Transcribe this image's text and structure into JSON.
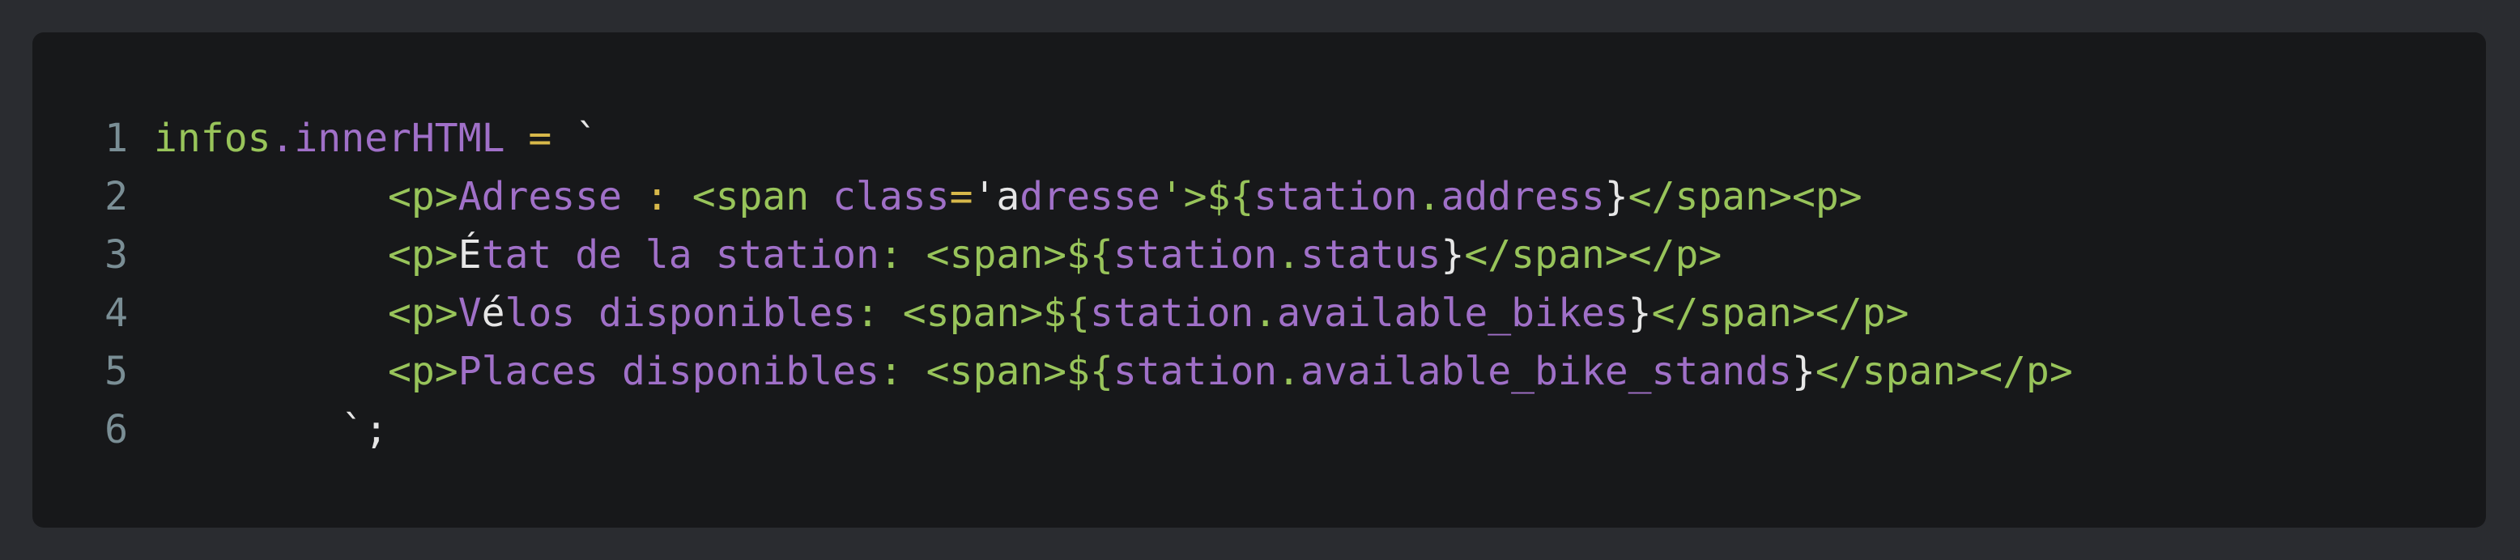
{
  "colors": {
    "background": "#2a2c30",
    "panel": "#17181a",
    "line_numbers": "#7a8e95",
    "tag_green": "#98c45a",
    "text_purple": "#a070c8",
    "operator_yellow": "#d7b84a",
    "plain_white": "#e6e6e6"
  },
  "code": {
    "lines": [
      {
        "number": "1",
        "segments": [
          {
            "text": "infos",
            "color": "g"
          },
          {
            "text": ".innerHTML ",
            "color": "p"
          },
          {
            "text": "=",
            "color": "y"
          },
          {
            "text": " `",
            "color": "w"
          }
        ]
      },
      {
        "number": "2",
        "segments": [
          {
            "text": "          ",
            "color": "p"
          },
          {
            "text": "<p>",
            "color": "g"
          },
          {
            "text": "Adresse ",
            "color": "p"
          },
          {
            "text": ":",
            "color": "y"
          },
          {
            "text": " ",
            "color": "p"
          },
          {
            "text": "<span ",
            "color": "g"
          },
          {
            "text": "class",
            "color": "p"
          },
          {
            "text": "=",
            "color": "y"
          },
          {
            "text": "'a",
            "color": "w"
          },
          {
            "text": "dresse",
            "color": "p"
          },
          {
            "text": "'>",
            "color": "g"
          },
          {
            "text": "${",
            "color": "g"
          },
          {
            "text": "station",
            "color": "p"
          },
          {
            "text": ".",
            "color": "g"
          },
          {
            "text": "address",
            "color": "p"
          },
          {
            "text": "}",
            "color": "w"
          },
          {
            "text": "</span><p>",
            "color": "g"
          }
        ]
      },
      {
        "number": "3",
        "segments": [
          {
            "text": "          ",
            "color": "p"
          },
          {
            "text": "<p>",
            "color": "g"
          },
          {
            "text": "É",
            "color": "w"
          },
          {
            "text": "tat de la station",
            "color": "p"
          },
          {
            "text": ": ",
            "color": "g"
          },
          {
            "text": "<span>",
            "color": "g"
          },
          {
            "text": "${",
            "color": "g"
          },
          {
            "text": "station",
            "color": "p"
          },
          {
            "text": ".",
            "color": "g"
          },
          {
            "text": "status",
            "color": "p"
          },
          {
            "text": "}",
            "color": "w"
          },
          {
            "text": "</span></p>",
            "color": "g"
          }
        ]
      },
      {
        "number": "4",
        "segments": [
          {
            "text": "          ",
            "color": "p"
          },
          {
            "text": "<p>",
            "color": "g"
          },
          {
            "text": "V",
            "color": "p"
          },
          {
            "text": "é",
            "color": "w"
          },
          {
            "text": "los disponibles",
            "color": "p"
          },
          {
            "text": ": ",
            "color": "g"
          },
          {
            "text": "<span>",
            "color": "g"
          },
          {
            "text": "${",
            "color": "g"
          },
          {
            "text": "station",
            "color": "p"
          },
          {
            "text": ".",
            "color": "g"
          },
          {
            "text": "available_bikes",
            "color": "p"
          },
          {
            "text": "}",
            "color": "w"
          },
          {
            "text": "</span></p>",
            "color": "g"
          }
        ]
      },
      {
        "number": "5",
        "segments": [
          {
            "text": "          ",
            "color": "p"
          },
          {
            "text": "<p>",
            "color": "g"
          },
          {
            "text": "Places disponibles",
            "color": "p"
          },
          {
            "text": ": ",
            "color": "g"
          },
          {
            "text": "<span>",
            "color": "g"
          },
          {
            "text": "${",
            "color": "g"
          },
          {
            "text": "station",
            "color": "p"
          },
          {
            "text": ".",
            "color": "g"
          },
          {
            "text": "available_bike_stands",
            "color": "p"
          },
          {
            "text": "}",
            "color": "w"
          },
          {
            "text": "</span></p>",
            "color": "g"
          }
        ]
      },
      {
        "number": "6",
        "segments": [
          {
            "text": "        ",
            "color": "p"
          },
          {
            "text": "`;",
            "color": "w"
          }
        ]
      }
    ]
  }
}
